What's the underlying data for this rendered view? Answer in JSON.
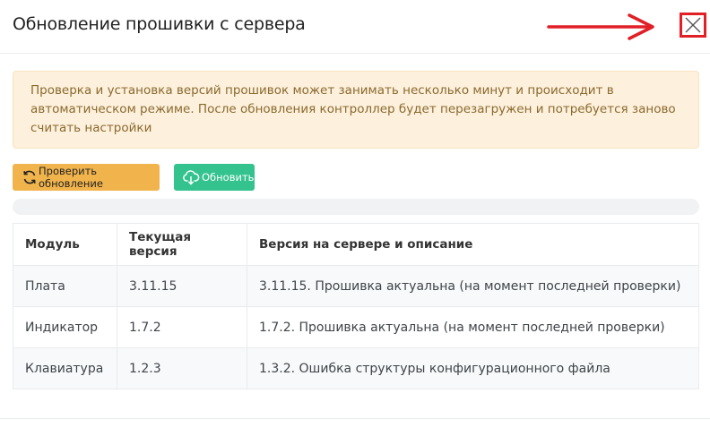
{
  "modal": {
    "title": "Обновление прошивки с сервера"
  },
  "annotation": {
    "arrow_color": "#e01f26",
    "close_icon": "close-icon"
  },
  "alert": {
    "text": "Проверка и установка версий прошивок может занимать несколько минут и происходит в автоматическом режиме. После обновления контроллер будет перезагружен и потребуется заново считать настройки"
  },
  "buttons": {
    "check": {
      "label": "Проверить обновление",
      "icon": "refresh-icon",
      "color": "#f1b44c"
    },
    "update": {
      "label": "Обновить",
      "icon": "cloud-download-icon",
      "color": "#34c38f"
    }
  },
  "progress": {
    "value": 0
  },
  "table": {
    "headers": [
      "Модуль",
      "Текущая версия",
      "Версия на сервере и описание"
    ],
    "rows": [
      [
        "Плата",
        "3.11.15",
        "3.11.15. Прошивка актуальна (на момент последней проверки)"
      ],
      [
        "Индикатор",
        "1.7.2",
        "1.7.2. Прошивка актуальна (на момент последней проверки)"
      ],
      [
        "Клавиатура",
        "1.2.3",
        "1.3.2. Ошибка структуры конфигурационного файла"
      ]
    ]
  }
}
